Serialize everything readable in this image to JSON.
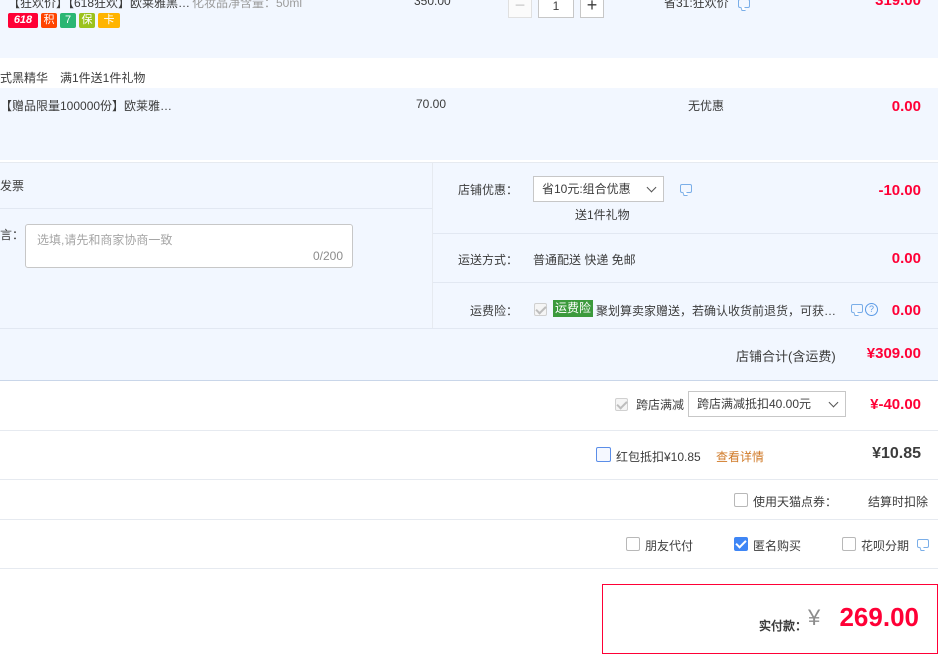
{
  "item1": {
    "title": "【狂欢价】【618狂欢】欧莱雅黑…",
    "spec": "化妆品净含量：50ml",
    "price": "350.00",
    "quantity": "1",
    "discount": "省31:狂欢价",
    "subtotal": "319.00",
    "badges": [
      "618",
      "积",
      "7",
      "保",
      "卡"
    ]
  },
  "gift": {
    "promo": "式黑精华　满1件送1件礼物",
    "title": "【赠品限量100000份】欧莱雅…",
    "price": "70.00",
    "discount": "无优惠",
    "subtotal": "0.00"
  },
  "invoice": {
    "label": "发票"
  },
  "message": {
    "label": "言：",
    "placeholder": "选填,请先和商家协商一致",
    "counter": "0/200"
  },
  "shop_discount": {
    "label": "店铺优惠：",
    "selected": "省10元:组合优惠",
    "note": "送1件礼物",
    "amount": "-10.00"
  },
  "shipping": {
    "label": "运送方式：",
    "value": "普通配送 快递 免邮",
    "amount": "0.00"
  },
  "insurance": {
    "label": "运费险：",
    "tag": "运费险",
    "text": "聚划算卖家赠送，若确认收货前退货，可获…",
    "amount": "0.00"
  },
  "shop_total": {
    "label": "店铺合计(含运费)",
    "amount": "¥309.00"
  },
  "cross_store": {
    "label": "跨店满减",
    "selected": "跨店满减抵扣40.00元",
    "amount": "¥-40.00"
  },
  "red_packet": {
    "label": "红包抵扣¥10.85",
    "link": "查看详情",
    "amount": "¥10.85"
  },
  "tmall_points": {
    "label": "使用天猫点券：",
    "note": "结算时扣除"
  },
  "options": {
    "friend_pay": "朋友代付",
    "anonymous": "匿名购买",
    "huabei": "花呗分期"
  },
  "payment": {
    "label": "实付款：",
    "currency": "¥",
    "amount": "269.00"
  },
  "colors": {
    "accent_red": "#ff0036",
    "row_blue": "#f2f7ff",
    "link_orange": "#d07a28",
    "check_blue": "#3f86f5"
  }
}
